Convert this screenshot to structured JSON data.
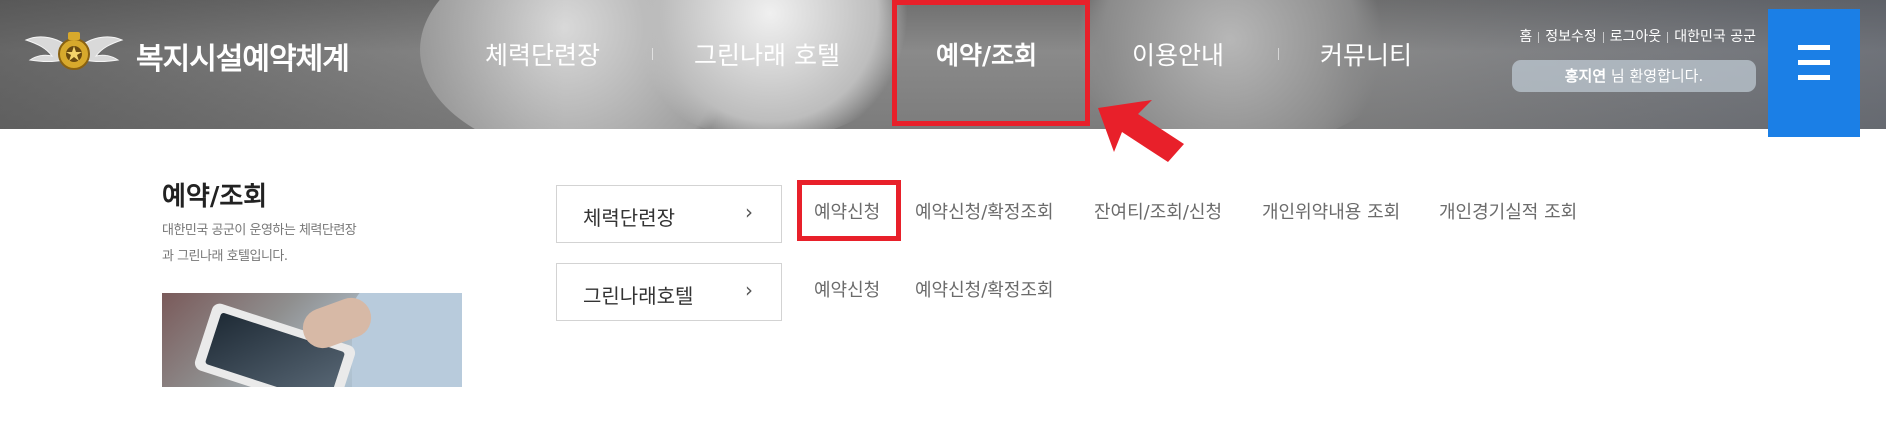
{
  "header": {
    "site_title": "복지시설예약체계",
    "gnb": [
      {
        "label": "체력단련장"
      },
      {
        "label": "그린나래 호텔"
      },
      {
        "label": "예약/조회"
      },
      {
        "label": "이용안내"
      },
      {
        "label": "커뮤니티"
      }
    ],
    "util_links": [
      "홈",
      "정보수정",
      "로그아웃",
      "대한민국 공군"
    ],
    "welcome": {
      "name": "홍지연",
      "suffix": " 님 환영합니다."
    },
    "highlight_color": "#e8202a",
    "menu_button_color": "#1b7fe6"
  },
  "sidebar": {
    "title": "예약/조회",
    "desc_line1": "대한민국 공군이 운영하는 체력단련장",
    "desc_line2": "과 그린나래 호텔입니다."
  },
  "categories": [
    {
      "label": "체력단련장",
      "chevron": "›",
      "links": [
        "예약신청",
        "예약신청/확정조회",
        "잔여티/조회/신청",
        "개인위약내용 조회",
        "개인경기실적 조회"
      ]
    },
    {
      "label": "그린나래호텔",
      "chevron": "›",
      "links": [
        "예약신청",
        "예약신청/확정조회"
      ]
    }
  ]
}
